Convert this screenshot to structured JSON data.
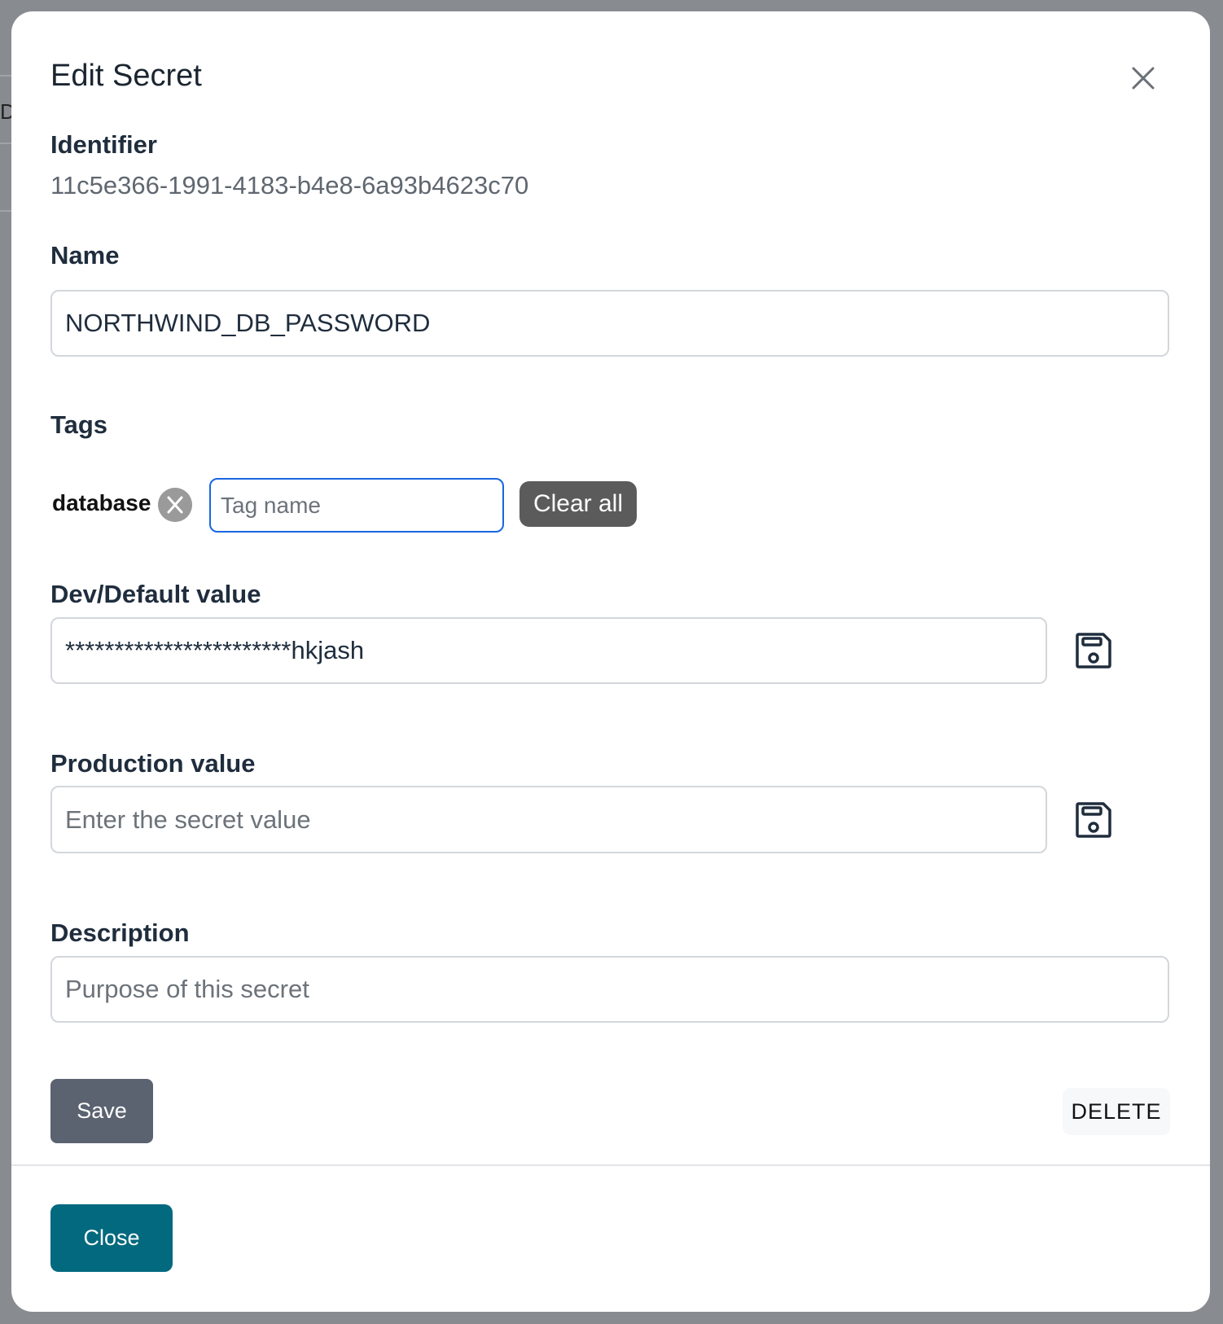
{
  "background": {
    "partial_letter": "D"
  },
  "modal": {
    "title": "Edit Secret",
    "identifier": {
      "label": "Identifier",
      "value": "11c5e366-1991-4183-b4e8-6a93b4623c70"
    },
    "name": {
      "label": "Name",
      "value": "NORTHWIND_DB_PASSWORD"
    },
    "tags": {
      "label": "Tags",
      "items": [
        {
          "label": "database"
        }
      ],
      "input_placeholder": "Tag name",
      "clear_all_label": "Clear all"
    },
    "dev_value": {
      "label": "Dev/Default value",
      "value": "***********************hkjash",
      "icon": "floppy-disk-icon"
    },
    "production_value": {
      "label": "Production value",
      "placeholder": "Enter the secret value",
      "icon": "floppy-disk-icon"
    },
    "description": {
      "label": "Description",
      "placeholder": "Purpose of this secret"
    },
    "save_label": "Save",
    "delete_label": "DELETE",
    "close_label": "Close"
  },
  "colors": {
    "tag_input_focus": "#1a66e0",
    "clear_all": "#5b5b5b",
    "save": "#5b6270",
    "close": "#03697e"
  }
}
